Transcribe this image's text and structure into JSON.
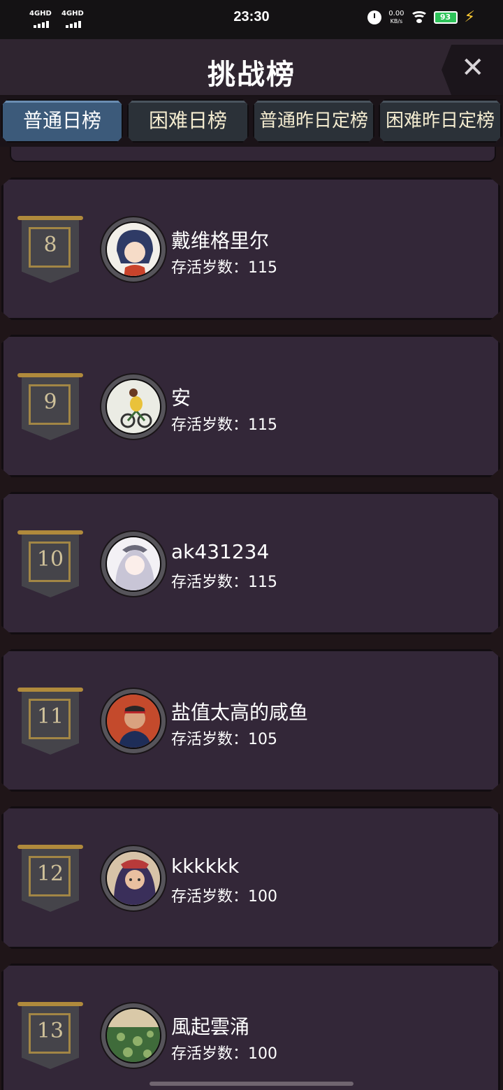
{
  "status_bar": {
    "network_1": "4GHD",
    "network_2": "4GHD",
    "time": "23:30",
    "speed_value": "0.00",
    "speed_unit": "KB/s",
    "battery": "93",
    "icons": [
      "signal-icon",
      "alarm-icon",
      "wifi-icon",
      "battery-icon",
      "charging-bolt-icon"
    ]
  },
  "header": {
    "title": "挑战榜",
    "close_icon": "close-icon",
    "close_label": "✕"
  },
  "tabs": [
    {
      "label": "普通日榜",
      "active": true
    },
    {
      "label": "困难日榜",
      "active": false
    },
    {
      "label": "普通昨日定榜",
      "active": false
    },
    {
      "label": "困难昨日定榜",
      "active": false
    }
  ],
  "score_label": "存活岁数：",
  "entries": [
    {
      "rank": "8",
      "name": "戴维格里尔",
      "score": "115",
      "avatar_colors": [
        "#f2efe9",
        "#2f3b66",
        "#c9432b"
      ]
    },
    {
      "rank": "9",
      "name": "安",
      "score": "115",
      "avatar_colors": [
        "#ebece4",
        "#e9c23a",
        "#3c6b3a"
      ]
    },
    {
      "rank": "10",
      "name": "ak431234",
      "score": "115",
      "avatar_colors": [
        "#f3f1f5",
        "#c8c5d6",
        "#6b6a7a"
      ]
    },
    {
      "rank": "11",
      "name": "盐值太高的咸鱼",
      "score": "105",
      "avatar_colors": [
        "#c44a2c",
        "#2a2626",
        "#1e2d58"
      ]
    },
    {
      "rank": "12",
      "name": "kkkkkk",
      "score": "100",
      "avatar_colors": [
        "#d7c3a8",
        "#3a2f5a",
        "#b83a3a"
      ]
    },
    {
      "rank": "13",
      "name": "風起雲涌",
      "score": "100",
      "avatar_colors": [
        "#3f6b3a",
        "#8fb06a",
        "#d9c9a8"
      ]
    }
  ]
}
